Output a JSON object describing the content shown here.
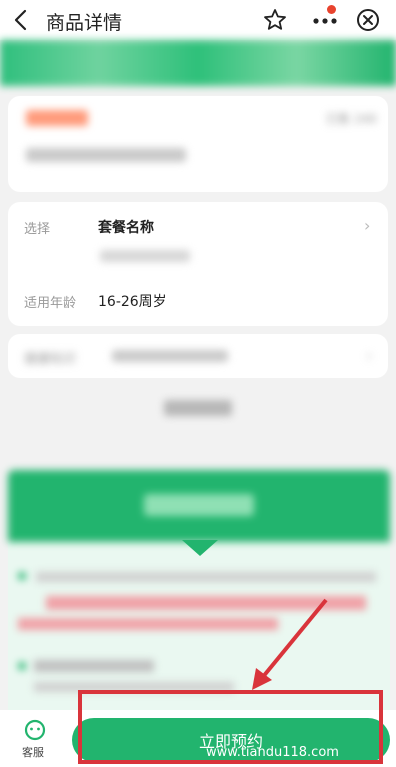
{
  "header": {
    "title": "商品详情",
    "icons": [
      "back-chevron-icon",
      "star-icon",
      "more-icon",
      "close-icon"
    ]
  },
  "product": {
    "sold_label": "已售 240"
  },
  "options": {
    "select_label": "选择",
    "select_value": "套餐名称",
    "age_label": "适用年龄",
    "age_value": "16-26周岁",
    "health_label": "健康知识"
  },
  "bottom": {
    "service_label": "客服",
    "book_label": "立即预约"
  },
  "watermark": "www.tiandu118.com",
  "colors": {
    "brand_green": "#22b46e",
    "annotation_red": "#d9343b"
  }
}
